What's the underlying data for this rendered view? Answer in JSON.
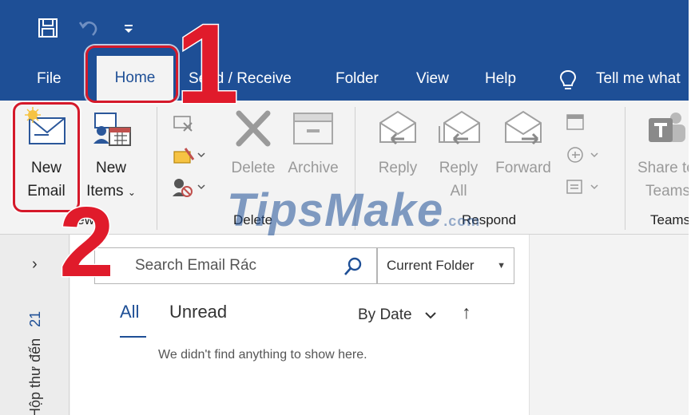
{
  "quick_access": {
    "save_icon": "save-icon",
    "undo_icon": "undo-icon",
    "customize_icon": "customize-qat-icon"
  },
  "tabs": {
    "file": "File",
    "home": "Home",
    "send_receive": "Send / Receive",
    "folder": "Folder",
    "view": "View",
    "help": "Help"
  },
  "tell_me": {
    "icon": "lightbulb-icon",
    "text": "Tell me what"
  },
  "ribbon": {
    "new": {
      "new_email_line1": "New",
      "new_email_line2": "Email",
      "new_items_line1": "New",
      "new_items_line2": "Items",
      "group_label": "New"
    },
    "delete": {
      "delete_label": "Delete",
      "archive_label": "Archive",
      "group_label": "Delete"
    },
    "respond": {
      "reply_label": "Reply",
      "reply_all_line1": "Reply",
      "reply_all_line2": "All",
      "forward_label": "Forward",
      "group_label": "Respond"
    },
    "teams": {
      "share_line1": "Share to",
      "share_line2": "Teams",
      "group_label": "Teams"
    }
  },
  "folder_pane": {
    "expand_icon": "chevron-right-icon",
    "folder_name": "Hộp thư đến",
    "unread_count": "21"
  },
  "message_list": {
    "search_placeholder": "Search Email Rác",
    "scope": "Current Folder",
    "filter_all": "All",
    "filter_unread": "Unread",
    "sort_label": "By Date",
    "sort_direction_icon": "arrow-up-icon",
    "empty_message": "We didn't find anything to show here."
  },
  "annotations": {
    "step_1": "1",
    "step_2": "2",
    "highlight_color": "#d5192a"
  },
  "watermark": {
    "text": "TipsMake",
    "ext": ".com"
  },
  "colors": {
    "brand_blue": "#1e4f96",
    "ribbon_bg": "#f3f3f3"
  }
}
